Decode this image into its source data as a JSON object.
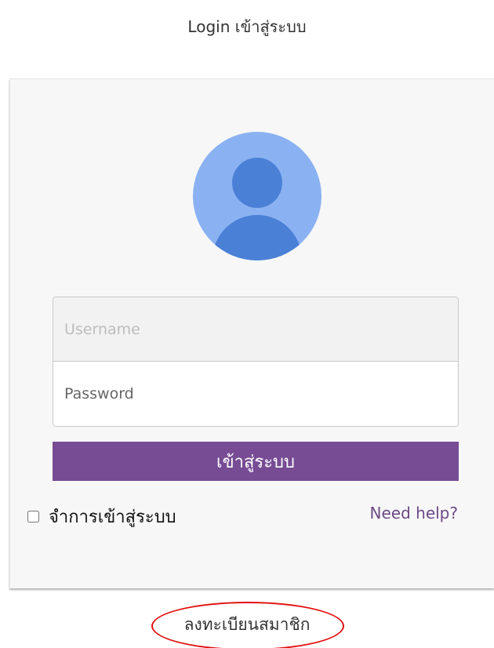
{
  "header": {
    "title": "Login เข้าสู่ระบบ"
  },
  "login_card": {
    "avatar_icon": "user-avatar-icon",
    "username": {
      "value": "",
      "placeholder": "Username"
    },
    "password": {
      "value": "",
      "placeholder": "Password"
    },
    "submit_label": "เข้าสู่ระบบ",
    "remember": {
      "label": "จำการเข้าสู่ระบบ",
      "checked": false
    },
    "help_label": "Need help?"
  },
  "footer": {
    "register_label": "ลงทะเบียนสมาชิก",
    "highlight_color": "#e01010"
  },
  "colors": {
    "accent": "#774c94",
    "avatar_background": "#8ab2f2",
    "avatar_figure": "#4a80d6"
  }
}
